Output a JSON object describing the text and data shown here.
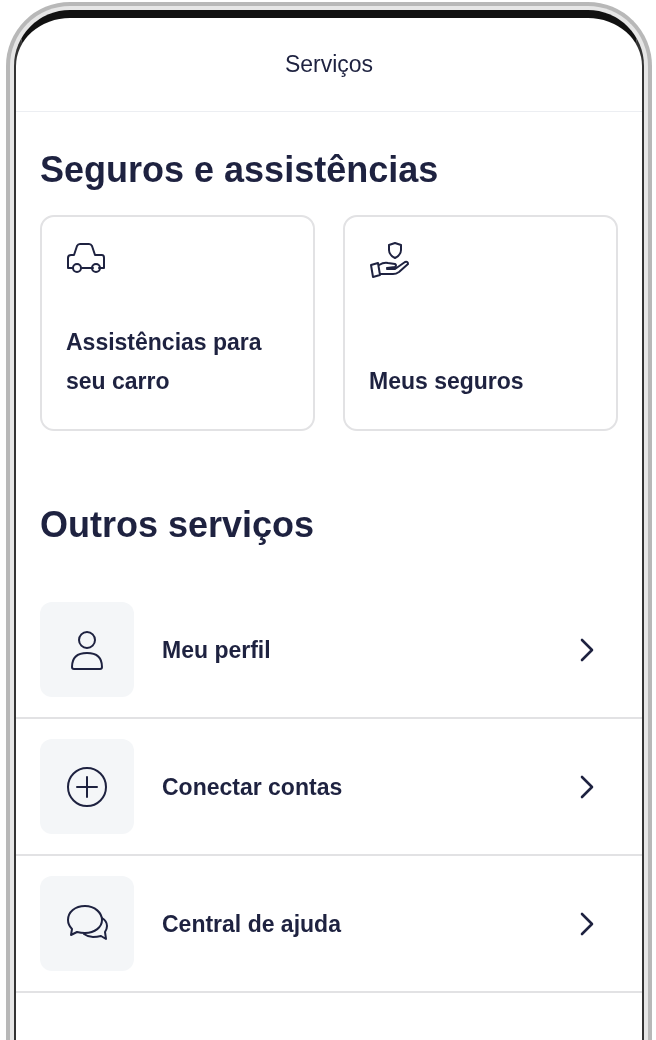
{
  "header": {
    "title": "Serviços"
  },
  "insurance_section": {
    "heading": "Seguros e assistências",
    "cards": [
      {
        "label": "Assistências para seu carro"
      },
      {
        "label": "Meus seguros"
      }
    ]
  },
  "other_section": {
    "heading": "Outros serviços",
    "items": [
      {
        "label": "Meu perfil"
      },
      {
        "label": "Conectar contas"
      },
      {
        "label": "Central de ajuda"
      }
    ]
  }
}
